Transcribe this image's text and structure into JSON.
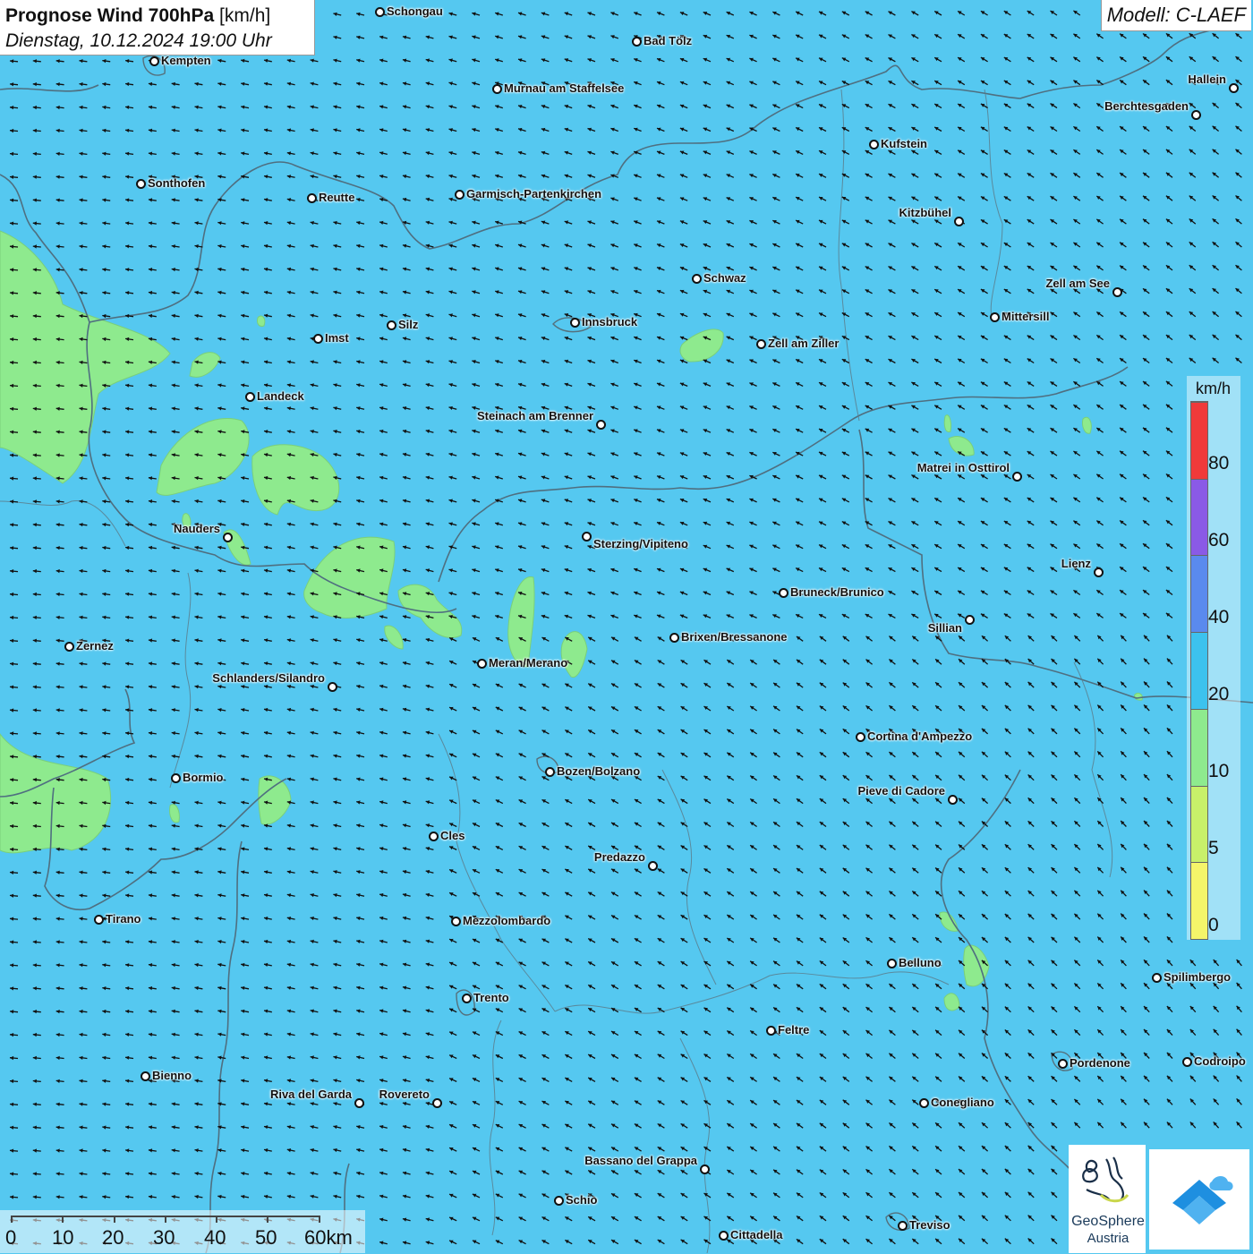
{
  "title": {
    "main": "Prognose Wind 700hPa",
    "unit": "[km/h]",
    "date": "Dienstag, 10.12.2024 19:00 Uhr"
  },
  "model": "Modell: C-LAEF",
  "legend": {
    "unit": "km/h",
    "labels": [
      "80",
      "60",
      "40",
      "20",
      "10",
      "5",
      "0"
    ],
    "classes": [
      {
        "color": "#f03a3a"
      },
      {
        "color": "#8a5ae6"
      },
      {
        "color": "#5a8aee"
      },
      {
        "color": "#3cc2ee"
      },
      {
        "color": "#8eea8e"
      },
      {
        "color": "#c8f06a"
      },
      {
        "color": "#f5f56a"
      }
    ]
  },
  "scale": {
    "labels": [
      "0",
      "10",
      "20",
      "30",
      "40",
      "50",
      "60km"
    ]
  },
  "logo": {
    "name_line1": "GeoSphere",
    "name_line2": "Austria"
  },
  "cities": [
    {
      "name": "Schongau"
    },
    {
      "name": "Bad Tölz"
    },
    {
      "name": "Kempten"
    },
    {
      "name": "Murnau am Staffelsee"
    },
    {
      "name": "Hallein"
    },
    {
      "name": "Berchtesgaden"
    },
    {
      "name": "Kufstein"
    },
    {
      "name": "Sonthofen"
    },
    {
      "name": "Reutte"
    },
    {
      "name": "Garmisch-Partenkirchen"
    },
    {
      "name": "Kitzbühel"
    },
    {
      "name": "Schwaz"
    },
    {
      "name": "Zell am See"
    },
    {
      "name": "Mittersill"
    },
    {
      "name": "Innsbruck"
    },
    {
      "name": "Silz"
    },
    {
      "name": "Imst"
    },
    {
      "name": "Zell am Ziller"
    },
    {
      "name": "Landeck"
    },
    {
      "name": "Steinach am Brenner"
    },
    {
      "name": "Matrei in Osttirol"
    },
    {
      "name": "Nauders"
    },
    {
      "name": "Sterzing/Vipiteno"
    },
    {
      "name": "Lienz"
    },
    {
      "name": "Bruneck/Brunico"
    },
    {
      "name": "Sillian"
    },
    {
      "name": "Brixen/Bressanone"
    },
    {
      "name": "Zernez"
    },
    {
      "name": "Meran/Merano"
    },
    {
      "name": "Schlanders/Silandro"
    },
    {
      "name": "Cortina d'Ampezzo"
    },
    {
      "name": "Bozen/Bolzano"
    },
    {
      "name": "Bormio"
    },
    {
      "name": "Pieve di Cadore"
    },
    {
      "name": "Cles"
    },
    {
      "name": "Predazzo"
    },
    {
      "name": "Tirano"
    },
    {
      "name": "Mezzolombardo"
    },
    {
      "name": "Belluno"
    },
    {
      "name": "Spilimbergo"
    },
    {
      "name": "Trento"
    },
    {
      "name": "Feltre"
    },
    {
      "name": "Pordenone"
    },
    {
      "name": "Codroipo"
    },
    {
      "name": "Bienno"
    },
    {
      "name": "Riva del Garda"
    },
    {
      "name": "Rovereto"
    },
    {
      "name": "Conegliano"
    },
    {
      "name": "Bassano del Grappa"
    },
    {
      "name": "Schio"
    },
    {
      "name": "Treviso"
    },
    {
      "name": "Cittadella"
    }
  ],
  "colors": {
    "background_class": "#55c8f0",
    "low_wind_class": "#8eea8e"
  }
}
